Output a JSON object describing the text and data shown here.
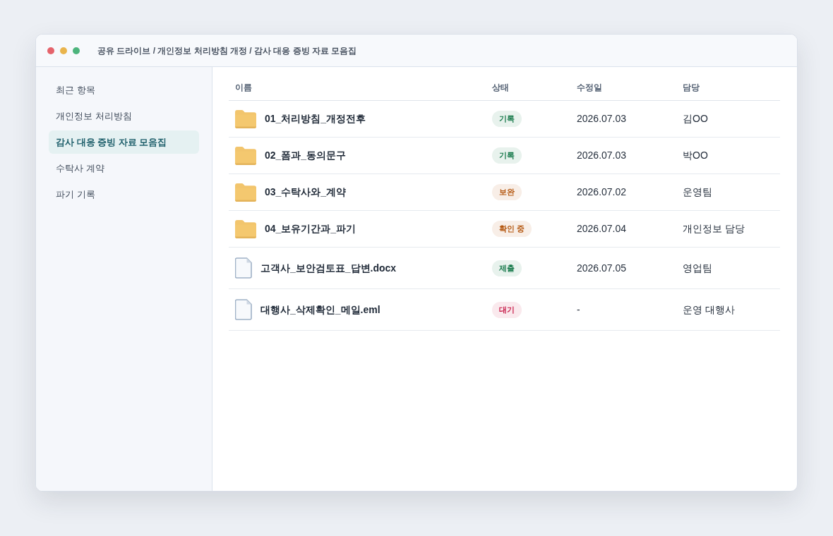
{
  "window": {
    "breadcrumb": "공유 드라이브 / 개인정보 처리방침 개정 / 감사 대응 증빙 자료 모음집"
  },
  "sidebar": {
    "items": [
      {
        "label": "최근 항목",
        "selected": false
      },
      {
        "label": "개인정보 처리방침",
        "selected": false
      },
      {
        "label": "감사 대응 증빙 자료 모음집",
        "selected": true
      },
      {
        "label": "수탁사 계약",
        "selected": false
      },
      {
        "label": "파기 기록",
        "selected": false
      }
    ]
  },
  "table": {
    "columns": [
      "이름",
      "상태",
      "수정일",
      "담당"
    ],
    "rows": [
      {
        "kind": "folder",
        "name": "01_처리방침_개정전후",
        "status": {
          "label": "기록",
          "color": "#16794a"
        },
        "modified": "2026.07.03",
        "owner": "김OO"
      },
      {
        "kind": "folder",
        "name": "02_폼과_동의문구",
        "status": {
          "label": "기록",
          "color": "#16794a"
        },
        "modified": "2026.07.03",
        "owner": "박OO"
      },
      {
        "kind": "folder",
        "name": "03_수탁사와_계약",
        "status": {
          "label": "보완",
          "color": "#b4560e"
        },
        "modified": "2026.07.02",
        "owner": "운영팀"
      },
      {
        "kind": "folder",
        "name": "04_보유기간과_파기",
        "status": {
          "label": "확인 중",
          "color": "#b4560e"
        },
        "modified": "2026.07.04",
        "owner": "개인정보 담당"
      },
      {
        "kind": "file",
        "name": "고객사_보안검토표_답변.docx",
        "status": {
          "label": "제출",
          "color": "#16794a"
        },
        "modified": "2026.07.05",
        "owner": "영업팀"
      },
      {
        "kind": "file",
        "name": "대행사_삭제확인_메일.eml",
        "status": {
          "label": "대기",
          "color": "#c8204c"
        },
        "modified": "-",
        "owner": "운영 대행사"
      }
    ]
  }
}
